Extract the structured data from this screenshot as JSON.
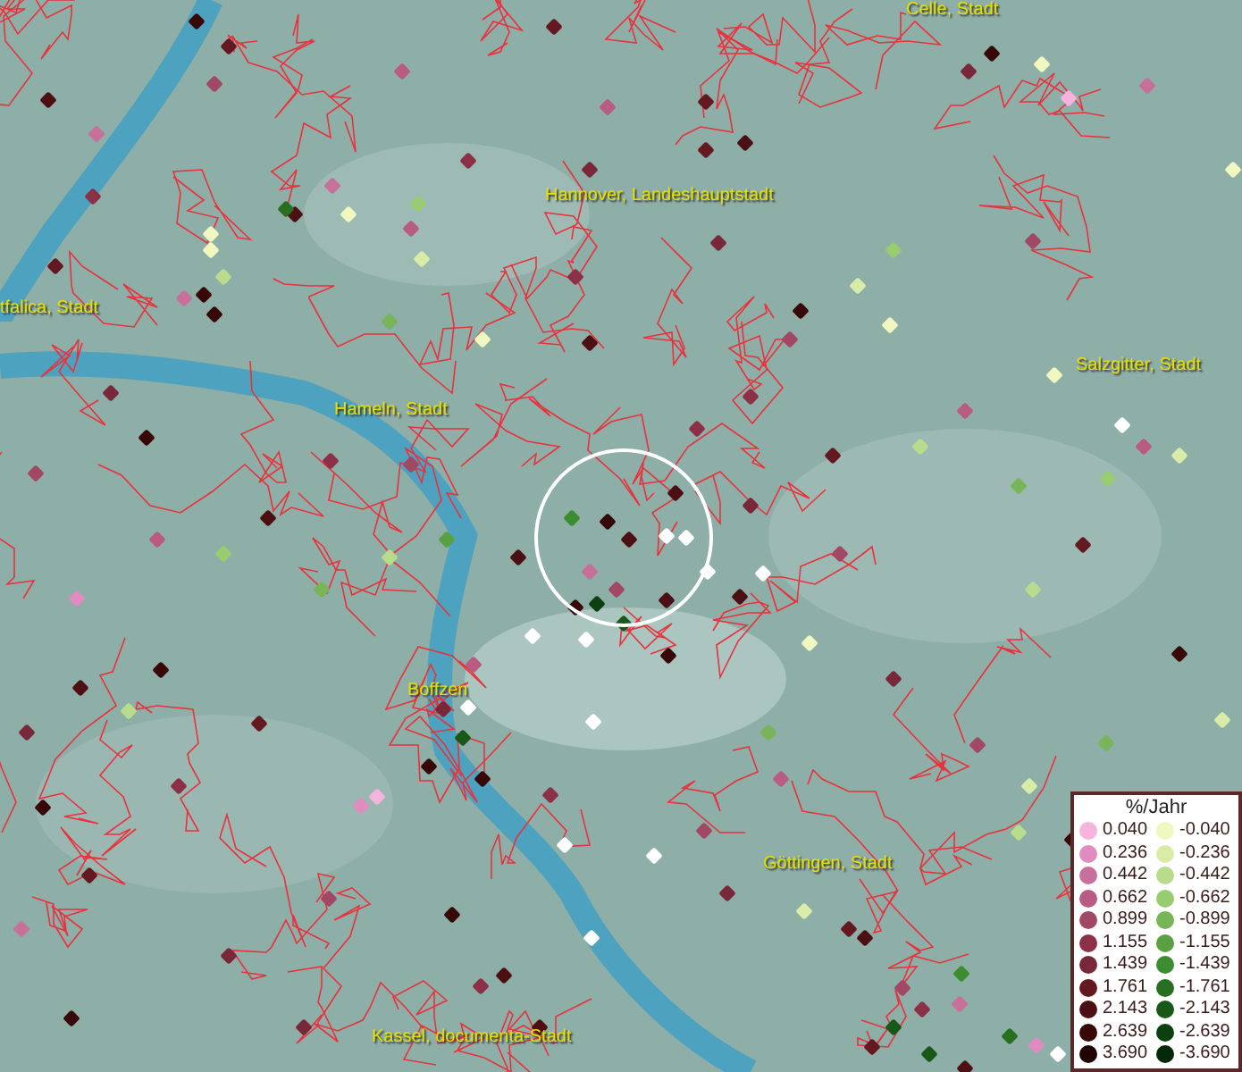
{
  "map_labels": [
    "Celle, Stadt",
    "Hannover, Landeshauptstadt",
    "tfalica, Stadt",
    "Salzgitter, Stadt",
    "Hameln, Stadt",
    "Boffzen",
    "Göttingen, Stadt",
    "Kassel, documenta-Stadt"
  ],
  "legend": {
    "title": "%/Jahr",
    "increase": [
      {
        "value": "0.040",
        "color": "#f4b4dc"
      },
      {
        "value": "0.236",
        "color": "#e08cc0"
      },
      {
        "value": "0.442",
        "color": "#c8709c"
      },
      {
        "value": "0.662",
        "color": "#b85c84"
      },
      {
        "value": "0.899",
        "color": "#a04864"
      },
      {
        "value": "1.155",
        "color": "#8c3048"
      },
      {
        "value": "1.439",
        "color": "#782838"
      },
      {
        "value": "1.761",
        "color": "#641820"
      },
      {
        "value": "2.143",
        "color": "#4c1014"
      },
      {
        "value": "2.639",
        "color": "#380808"
      },
      {
        "value": "3.690",
        "color": "#200404"
      }
    ],
    "decrease": [
      {
        "value": "-0.040",
        "color": "#f0f8c0"
      },
      {
        "value": "-0.236",
        "color": "#d8eca8"
      },
      {
        "value": "-0.442",
        "color": "#b8dc8c"
      },
      {
        "value": "-0.662",
        "color": "#98cc70"
      },
      {
        "value": "-0.899",
        "color": "#78b458"
      },
      {
        "value": "-1.155",
        "color": "#58a040"
      },
      {
        "value": "-1.439",
        "color": "#3c8c30"
      },
      {
        "value": "-1.761",
        "color": "#287020"
      },
      {
        "value": "-2.143",
        "color": "#185818"
      },
      {
        "value": "-2.639",
        "color": "#0c4010"
      },
      {
        "value": "-3.690",
        "color": "#042808"
      }
    ]
  }
}
